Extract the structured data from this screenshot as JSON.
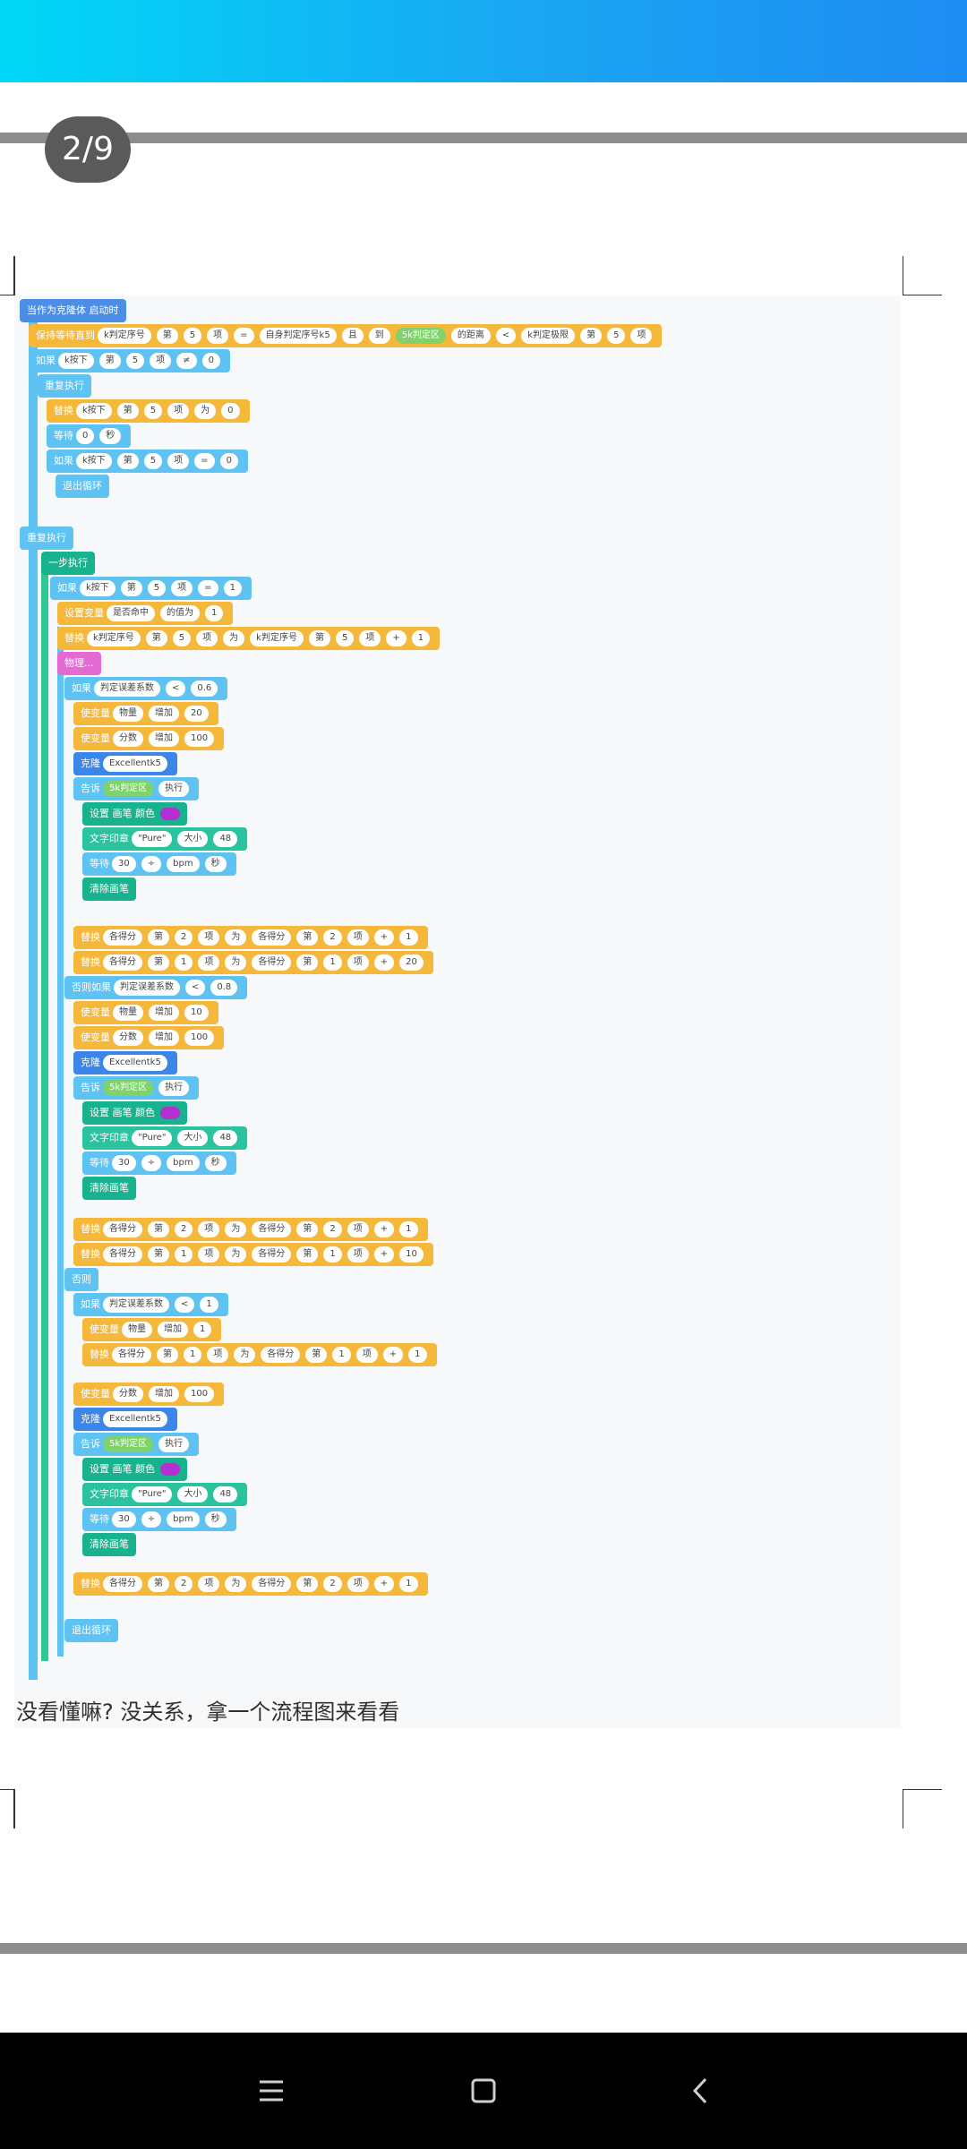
{
  "page_indicator": "2/9",
  "caption": "没看懂嘛? 没关系，拿一个流程图来看看",
  "colors": {
    "topbar": "#1aa6f2",
    "event_block": "#4b8ee6",
    "control_block": "#5ec3f2",
    "list_block": "#f6b83a",
    "pen_block": "#18b38e",
    "pen_color": "#b62fd1"
  },
  "nav": {
    "menu_icon": "menu-icon",
    "home_icon": "home-icon",
    "back_icon": "back-icon"
  },
  "blocks": {
    "hat": "当作为克隆体 启动时",
    "wait_until": "保持等待直到",
    "wait_until_args": [
      "k判定序号",
      "第",
      "5",
      "项",
      "=",
      "自身判定序号k5",
      "且",
      "到",
      "5k判定区",
      "的距离",
      "<",
      "k判定极限",
      "第",
      "5",
      "项"
    ],
    "if1": "如果",
    "if1_args": [
      "k按下",
      "第",
      "5",
      "项",
      "≠",
      "0"
    ],
    "repeat1": "重复执行",
    "replace1": "替换",
    "replace1_args": [
      "k按下",
      "第",
      "5",
      "项",
      "为",
      "0"
    ],
    "wait1": "等待",
    "wait1_args": [
      "0",
      "秒"
    ],
    "if2": "如果",
    "if2_args": [
      "k按下",
      "第",
      "5",
      "项",
      "=",
      "0"
    ],
    "break1": "退出循环",
    "repeat2": "重复执行",
    "step": "一步执行",
    "if3": "如果",
    "if3_args": [
      "k按下",
      "第",
      "5",
      "项",
      "=",
      "1"
    ],
    "set_hit": "设置变量",
    "set_hit_args": [
      "是否命中",
      "的值为",
      "1"
    ],
    "replace2": "替换",
    "replace2_args": [
      "k判定序号",
      "第",
      "5",
      "项",
      "为",
      "k判定序号",
      "第",
      "5",
      "项",
      "+",
      "1"
    ],
    "physics": "物理...",
    "if4": "如果",
    "if4_args": [
      "判定误差系数",
      "<",
      "0.6"
    ],
    "change1": "使变量",
    "change1_args": [
      "物量",
      "增加",
      "20"
    ],
    "change2": "使变量",
    "change2_args": [
      "分数",
      "增加",
      "100"
    ],
    "clone1": "克隆",
    "clone1_args": [
      "Excellentk5"
    ],
    "tell1": "告诉",
    "tell1_args": [
      "5k判定区",
      "执行"
    ],
    "pen_color1": "设置 画笔 颜色",
    "print1": "文字印章",
    "print1_args": [
      "\"Pure\"",
      "大小",
      "48"
    ],
    "wait2": "等待",
    "wait2_args": [
      "30",
      "÷",
      "bpm",
      "秒"
    ],
    "clear1": "清除画笔",
    "replace3": "替换",
    "replace3_args": [
      "各得分",
      "第",
      "2",
      "项",
      "为",
      "各得分",
      "第",
      "2",
      "项",
      "+",
      "1"
    ],
    "replace4": "替换",
    "replace4_args": [
      "各得分",
      "第",
      "1",
      "项",
      "为",
      "各得分",
      "第",
      "1",
      "项",
      "+",
      "20"
    ],
    "else_if1": "否则如果",
    "else_if1_args": [
      "判定误差系数",
      "<",
      "0.8"
    ],
    "change3": "使变量",
    "change3_args": [
      "物量",
      "增加",
      "10"
    ],
    "change4": "使变量",
    "change4_args": [
      "分数",
      "增加",
      "100"
    ],
    "clone2": "克隆",
    "clone2_args": [
      "Excellentk5"
    ],
    "tell2": "告诉",
    "tell2_args": [
      "5k判定区",
      "执行"
    ],
    "pen_color2": "设置 画笔 颜色",
    "print2": "文字印章",
    "print2_args": [
      "\"Pure\"",
      "大小",
      "48"
    ],
    "wait3": "等待",
    "wait3_args": [
      "30",
      "÷",
      "bpm",
      "秒"
    ],
    "clear2": "清除画笔",
    "replace5": "替换",
    "replace5_args": [
      "各得分",
      "第",
      "2",
      "项",
      "为",
      "各得分",
      "第",
      "2",
      "项",
      "+",
      "1"
    ],
    "replace6": "替换",
    "replace6_args": [
      "各得分",
      "第",
      "1",
      "项",
      "为",
      "各得分",
      "第",
      "1",
      "项",
      "+",
      "10"
    ],
    "else1": "否则",
    "if5": "如果",
    "if5_args": [
      "判定误差系数",
      "<",
      "1"
    ],
    "change5": "使变量",
    "change5_args": [
      "物量",
      "增加",
      "1"
    ],
    "replace7": "替换",
    "replace7_args": [
      "各得分",
      "第",
      "1",
      "项",
      "为",
      "各得分",
      "第",
      "1",
      "项",
      "+",
      "1"
    ],
    "change6": "使变量",
    "change6_args": [
      "分数",
      "增加",
      "100"
    ],
    "clone3": "克隆",
    "clone3_args": [
      "Excellentk5"
    ],
    "tell3": "告诉",
    "tell3_args": [
      "5k判定区",
      "执行"
    ],
    "pen_color3": "设置 画笔 颜色",
    "print3": "文字印章",
    "print3_args": [
      "\"Pure\"",
      "大小",
      "48"
    ],
    "wait4": "等待",
    "wait4_args": [
      "30",
      "÷",
      "bpm",
      "秒"
    ],
    "clear3": "清除画笔",
    "replace8": "替换",
    "replace8_args": [
      "各得分",
      "第",
      "2",
      "项",
      "为",
      "各得分",
      "第",
      "2",
      "项",
      "+",
      "1"
    ],
    "break2": "退出循环"
  }
}
